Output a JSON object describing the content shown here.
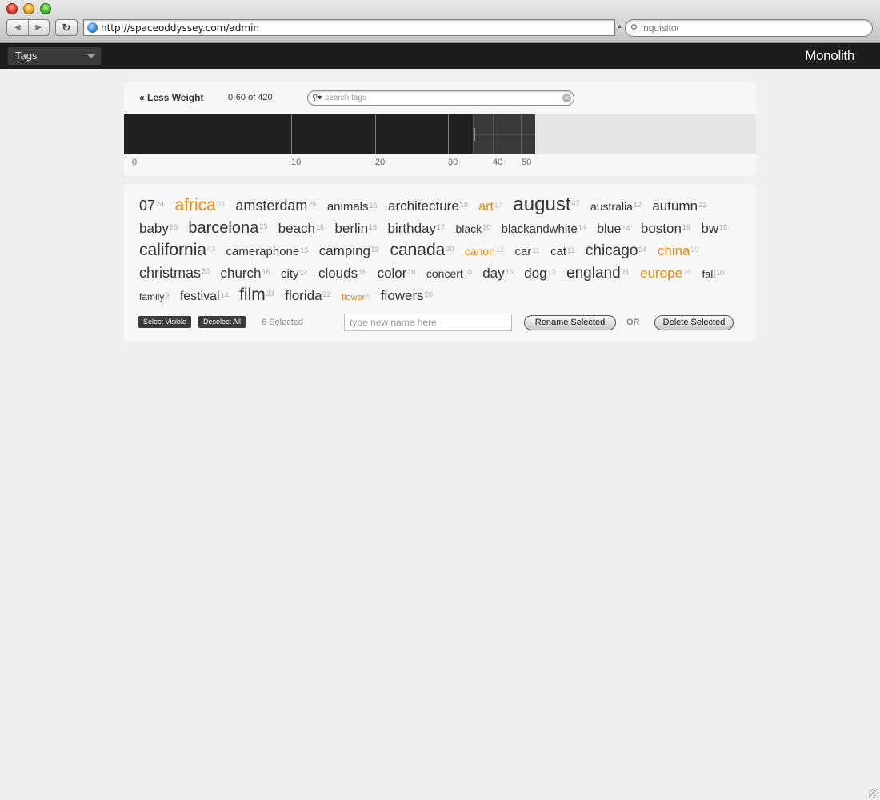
{
  "browser": {
    "url": "http://spaceoddyssey.com/admin",
    "search_placeholder": "Inquisitor"
  },
  "app": {
    "section_select": "Tags",
    "brand": "Monolith"
  },
  "toolbar": {
    "less_weight": "« Less Weight",
    "range": "0-60 of 420",
    "search_placeholder": "search tags"
  },
  "histogram": {
    "tick_labels": [
      "0",
      "10",
      "20",
      "30",
      "40",
      "50"
    ]
  },
  "tags": [
    {
      "name": "07",
      "count": "24",
      "size": 18,
      "selected": false
    },
    {
      "name": "africa",
      "count": "33",
      "size": 21,
      "selected": true
    },
    {
      "name": "amsterdam",
      "count": "26",
      "size": 18,
      "selected": false
    },
    {
      "name": "animals",
      "count": "16",
      "size": 15,
      "selected": false
    },
    {
      "name": "architecture",
      "count": "19",
      "size": 17,
      "selected": false
    },
    {
      "name": "art",
      "count": "17",
      "size": 16,
      "selected": true
    },
    {
      "name": "august",
      "count": "47",
      "size": 24,
      "selected": false
    },
    {
      "name": "australia",
      "count": "12",
      "size": 14,
      "selected": false
    },
    {
      "name": "autumn",
      "count": "22",
      "size": 17,
      "selected": false
    },
    {
      "name": "baby",
      "count": "26",
      "size": 17,
      "selected": false
    },
    {
      "name": "barcelona",
      "count": "29",
      "size": 20,
      "selected": false
    },
    {
      "name": "beach",
      "count": "16",
      "size": 17,
      "selected": false
    },
    {
      "name": "berlin",
      "count": "16",
      "size": 17,
      "selected": false
    },
    {
      "name": "birthday",
      "count": "17",
      "size": 17,
      "selected": false
    },
    {
      "name": "black",
      "count": "10",
      "size": 14,
      "selected": false
    },
    {
      "name": "blackandwhite",
      "count": "13",
      "size": 15,
      "selected": false
    },
    {
      "name": "blue",
      "count": "14",
      "size": 16,
      "selected": false
    },
    {
      "name": "boston",
      "count": "16",
      "size": 17,
      "selected": false
    },
    {
      "name": "bw",
      "count": "18",
      "size": 17,
      "selected": false
    },
    {
      "name": "california",
      "count": "43",
      "size": 21,
      "selected": false
    },
    {
      "name": "cameraphone",
      "count": "15",
      "size": 15,
      "selected": false
    },
    {
      "name": "camping",
      "count": "18",
      "size": 17,
      "selected": false
    },
    {
      "name": "canada",
      "count": "30",
      "size": 21,
      "selected": false
    },
    {
      "name": "canon",
      "count": "12",
      "size": 14,
      "selected": true
    },
    {
      "name": "car",
      "count": "11",
      "size": 15,
      "selected": false
    },
    {
      "name": "cat",
      "count": "11",
      "size": 15,
      "selected": false
    },
    {
      "name": "chicago",
      "count": "24",
      "size": 19,
      "selected": false
    },
    {
      "name": "china",
      "count": "20",
      "size": 17,
      "selected": true
    },
    {
      "name": "christmas",
      "count": "20",
      "size": 18,
      "selected": false
    },
    {
      "name": "church",
      "count": "16",
      "size": 17,
      "selected": false
    },
    {
      "name": "city",
      "count": "14",
      "size": 15,
      "selected": false
    },
    {
      "name": "clouds",
      "count": "16",
      "size": 17,
      "selected": false
    },
    {
      "name": "color",
      "count": "16",
      "size": 17,
      "selected": false
    },
    {
      "name": "concert",
      "count": "10",
      "size": 14,
      "selected": false
    },
    {
      "name": "day",
      "count": "16",
      "size": 17,
      "selected": false
    },
    {
      "name": "dog",
      "count": "13",
      "size": 17,
      "selected": false
    },
    {
      "name": "england",
      "count": "21",
      "size": 19,
      "selected": false
    },
    {
      "name": "europe",
      "count": "18",
      "size": 17,
      "selected": true
    },
    {
      "name": "fall",
      "count": "10",
      "size": 13,
      "selected": false
    },
    {
      "name": "family",
      "count": "9",
      "size": 12,
      "selected": false
    },
    {
      "name": "festival",
      "count": "14",
      "size": 16,
      "selected": false
    },
    {
      "name": "film",
      "count": "33",
      "size": 21,
      "selected": false
    },
    {
      "name": "florida",
      "count": "22",
      "size": 17,
      "selected": false
    },
    {
      "name": "flower",
      "count": "6",
      "size": 11,
      "selected": true
    },
    {
      "name": "flowers",
      "count": "20",
      "size": 17,
      "selected": false
    }
  ],
  "actions": {
    "select_visible": "Select Visible",
    "deselect_all": "Deselect All",
    "selected_count": "6 Selected",
    "rename_placeholder": "type new name here",
    "rename_selected": "Rename Selected",
    "or": "OR",
    "delete_selected": "Delete Selected"
  },
  "colors": {
    "selected_tag": "#e8890c",
    "appbar": "#1d1d1d"
  }
}
